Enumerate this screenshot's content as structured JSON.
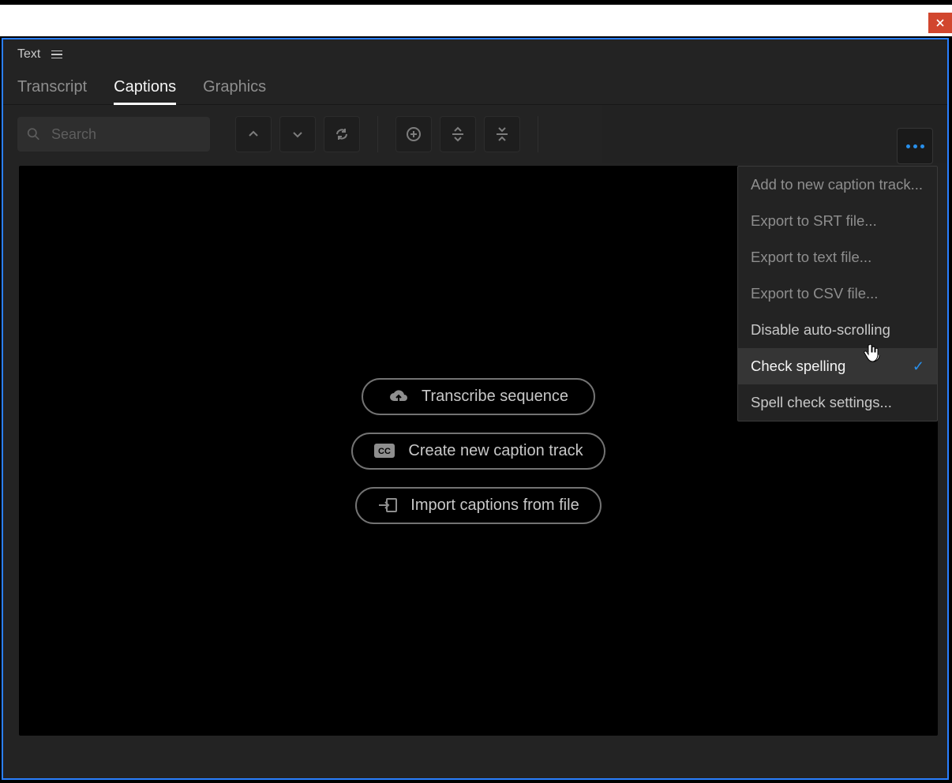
{
  "panel": {
    "title": "Text"
  },
  "tabs": [
    {
      "label": "Transcript",
      "active": false
    },
    {
      "label": "Captions",
      "active": true
    },
    {
      "label": "Graphics",
      "active": false
    }
  ],
  "search": {
    "placeholder": "Search"
  },
  "empty_actions": {
    "transcribe": "Transcribe sequence",
    "new_track": "Create new caption track",
    "import_file": "Import captions from file"
  },
  "menu": {
    "add_track": "Add to new caption track...",
    "export_srt": "Export to SRT file...",
    "export_text": "Export to text file...",
    "export_csv": "Export to CSV file...",
    "disable_autoscroll": "Disable auto-scrolling",
    "check_spelling": "Check spelling",
    "spellcheck_settings": "Spell check settings..."
  }
}
